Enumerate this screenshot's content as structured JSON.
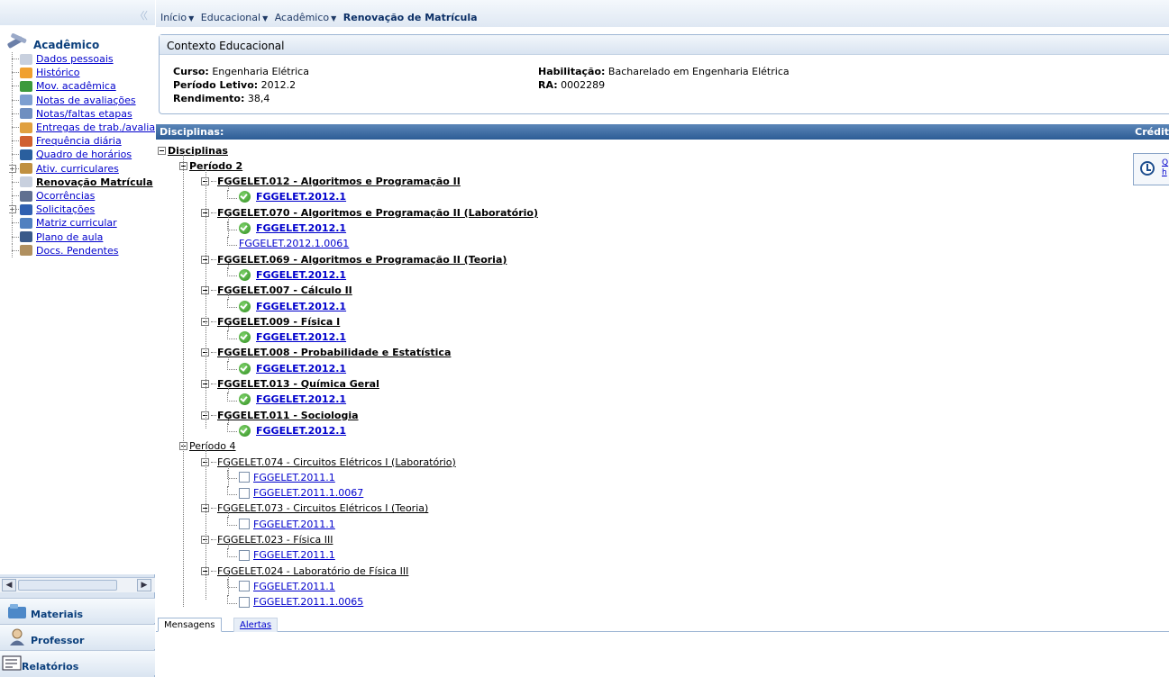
{
  "sidebar": {
    "section_title": "Acadêmico",
    "items": [
      {
        "label": "Dados pessoais",
        "active": false,
        "expandable": false,
        "icon": "person-card-icon",
        "color": "#c8d0de"
      },
      {
        "label": "Histórico",
        "active": false,
        "expandable": false,
        "icon": "pencil-doc-icon",
        "color": "#f0a030"
      },
      {
        "label": "Mov. acadêmica",
        "active": false,
        "expandable": false,
        "icon": "move-arrow-icon",
        "color": "#3c9a3c"
      },
      {
        "label": "Notas de avaliações",
        "active": false,
        "expandable": false,
        "icon": "grades-icon",
        "color": "#7d9fd0"
      },
      {
        "label": "Notas/faltas etapas",
        "active": false,
        "expandable": false,
        "icon": "table-icon",
        "color": "#6f8fc0"
      },
      {
        "label": "Entregas de trab./avaliações",
        "active": false,
        "expandable": false,
        "icon": "folder-icon",
        "color": "#e0a040"
      },
      {
        "label": "Frequência diária",
        "active": false,
        "expandable": false,
        "icon": "calendar-icon",
        "color": "#d06030"
      },
      {
        "label": "Quadro de horários",
        "active": false,
        "expandable": false,
        "icon": "clock-icon",
        "color": "#2a5f9e"
      },
      {
        "label": "Ativ. curriculares",
        "active": false,
        "expandable": true,
        "icon": "activity-icon",
        "color": "#c09040"
      },
      {
        "label": "Renovação Matrícula",
        "active": true,
        "expandable": false,
        "icon": "renewal-icon",
        "color": "#c8d0de"
      },
      {
        "label": "Ocorrências",
        "active": false,
        "expandable": false,
        "icon": "occurrence-icon",
        "color": "#607090"
      },
      {
        "label": "Solicitações",
        "active": false,
        "expandable": true,
        "icon": "request-icon",
        "color": "#3060b0"
      },
      {
        "label": "Matriz curricular",
        "active": false,
        "expandable": false,
        "icon": "curriculum-icon",
        "color": "#5080c0"
      },
      {
        "label": "Plano de aula",
        "active": false,
        "expandable": false,
        "icon": "book-icon",
        "color": "#3a5a8a"
      },
      {
        "label": "Docs. Pendentes",
        "active": false,
        "expandable": false,
        "icon": "pending-docs-icon",
        "color": "#b09060"
      }
    ],
    "bottom_sections": [
      {
        "label": "Materiais",
        "icon": "materials-icon"
      },
      {
        "label": "Professor",
        "icon": "professor-icon"
      },
      {
        "label": "Relatórios",
        "icon": "reports-icon"
      }
    ]
  },
  "breadcrumb": {
    "items": [
      "Início",
      "Educacional",
      "Acadêmico"
    ],
    "current": "Renovação de Matrícula"
  },
  "context": {
    "title": "Contexto Educacional",
    "curso_label": "Curso:",
    "curso_value": "Engenharia Elétrica",
    "periodo_label": "Período Letivo:",
    "periodo_value": "2012.2",
    "rendimento_label": "Rendimento:",
    "rendimento_value": "38,4",
    "habilitacao_label": "Habilitação:",
    "habilitacao_value": "Bacharelado em Engenharia Elétrica",
    "ra_label": "RA:",
    "ra_value": "0002289"
  },
  "disciplinas": {
    "header_left": "Disciplinas:",
    "header_right": "Crédit",
    "root": "Disciplinas",
    "credit_box_lines": [
      "Q",
      "h"
    ],
    "periods": [
      {
        "label": "Período 2",
        "bold": true,
        "courses": [
          {
            "label": "FGGELET.012 - Algoritmos e Programação II",
            "offers": [
              {
                "label": "FGGELET.2012.1",
                "type": "check"
              }
            ]
          },
          {
            "label": "FGGELET.070 - Algoritmos e Programação II (Laboratório)",
            "offers": [
              {
                "label": "FGGELET.2012.1",
                "type": "check"
              },
              {
                "label": "FGGELET.2012.1.0061",
                "type": "plain"
              }
            ]
          },
          {
            "label": "FGGELET.069 - Algoritmos e Programação II (Teoria)",
            "offers": [
              {
                "label": "FGGELET.2012.1",
                "type": "check"
              }
            ]
          },
          {
            "label": "FGGELET.007 - Cálculo II",
            "offers": [
              {
                "label": "FGGELET.2012.1",
                "type": "check"
              }
            ]
          },
          {
            "label": "FGGELET.009 - Física I",
            "offers": [
              {
                "label": "FGGELET.2012.1",
                "type": "check"
              }
            ]
          },
          {
            "label": "FGGELET.008 - Probabilidade e Estatística",
            "offers": [
              {
                "label": "FGGELET.2012.1",
                "type": "check"
              }
            ]
          },
          {
            "label": "FGGELET.013 - Química Geral",
            "offers": [
              {
                "label": "FGGELET.2012.1",
                "type": "check"
              }
            ]
          },
          {
            "label": "FGGELET.011 - Sociologia",
            "offers": [
              {
                "label": "FGGELET.2012.1",
                "type": "check"
              }
            ]
          }
        ]
      },
      {
        "label": "Período 4",
        "bold": false,
        "courses": [
          {
            "label": "FGGELET.074 - Circuitos Elétricos I (Laboratório)",
            "offers": [
              {
                "label": "FGGELET.2011.1",
                "type": "box"
              },
              {
                "label": "FGGELET.2011.1.0067",
                "type": "box"
              }
            ]
          },
          {
            "label": "FGGELET.073 - Circuitos Elétricos I (Teoria)",
            "offers": [
              {
                "label": "FGGELET.2011.1",
                "type": "box"
              }
            ]
          },
          {
            "label": "FGGELET.023 - Física III",
            "offers": [
              {
                "label": "FGGELET.2011.1",
                "type": "box"
              }
            ]
          },
          {
            "label": "FGGELET.024 - Laboratório de Física III",
            "offers": [
              {
                "label": "FGGELET.2011.1",
                "type": "box"
              },
              {
                "label": "FGGELET.2011.1.0065",
                "type": "box"
              }
            ]
          }
        ]
      }
    ]
  },
  "tabs": {
    "items": [
      {
        "label": "Mensagens",
        "active": true
      },
      {
        "label": "Alertas",
        "active": false
      }
    ]
  }
}
